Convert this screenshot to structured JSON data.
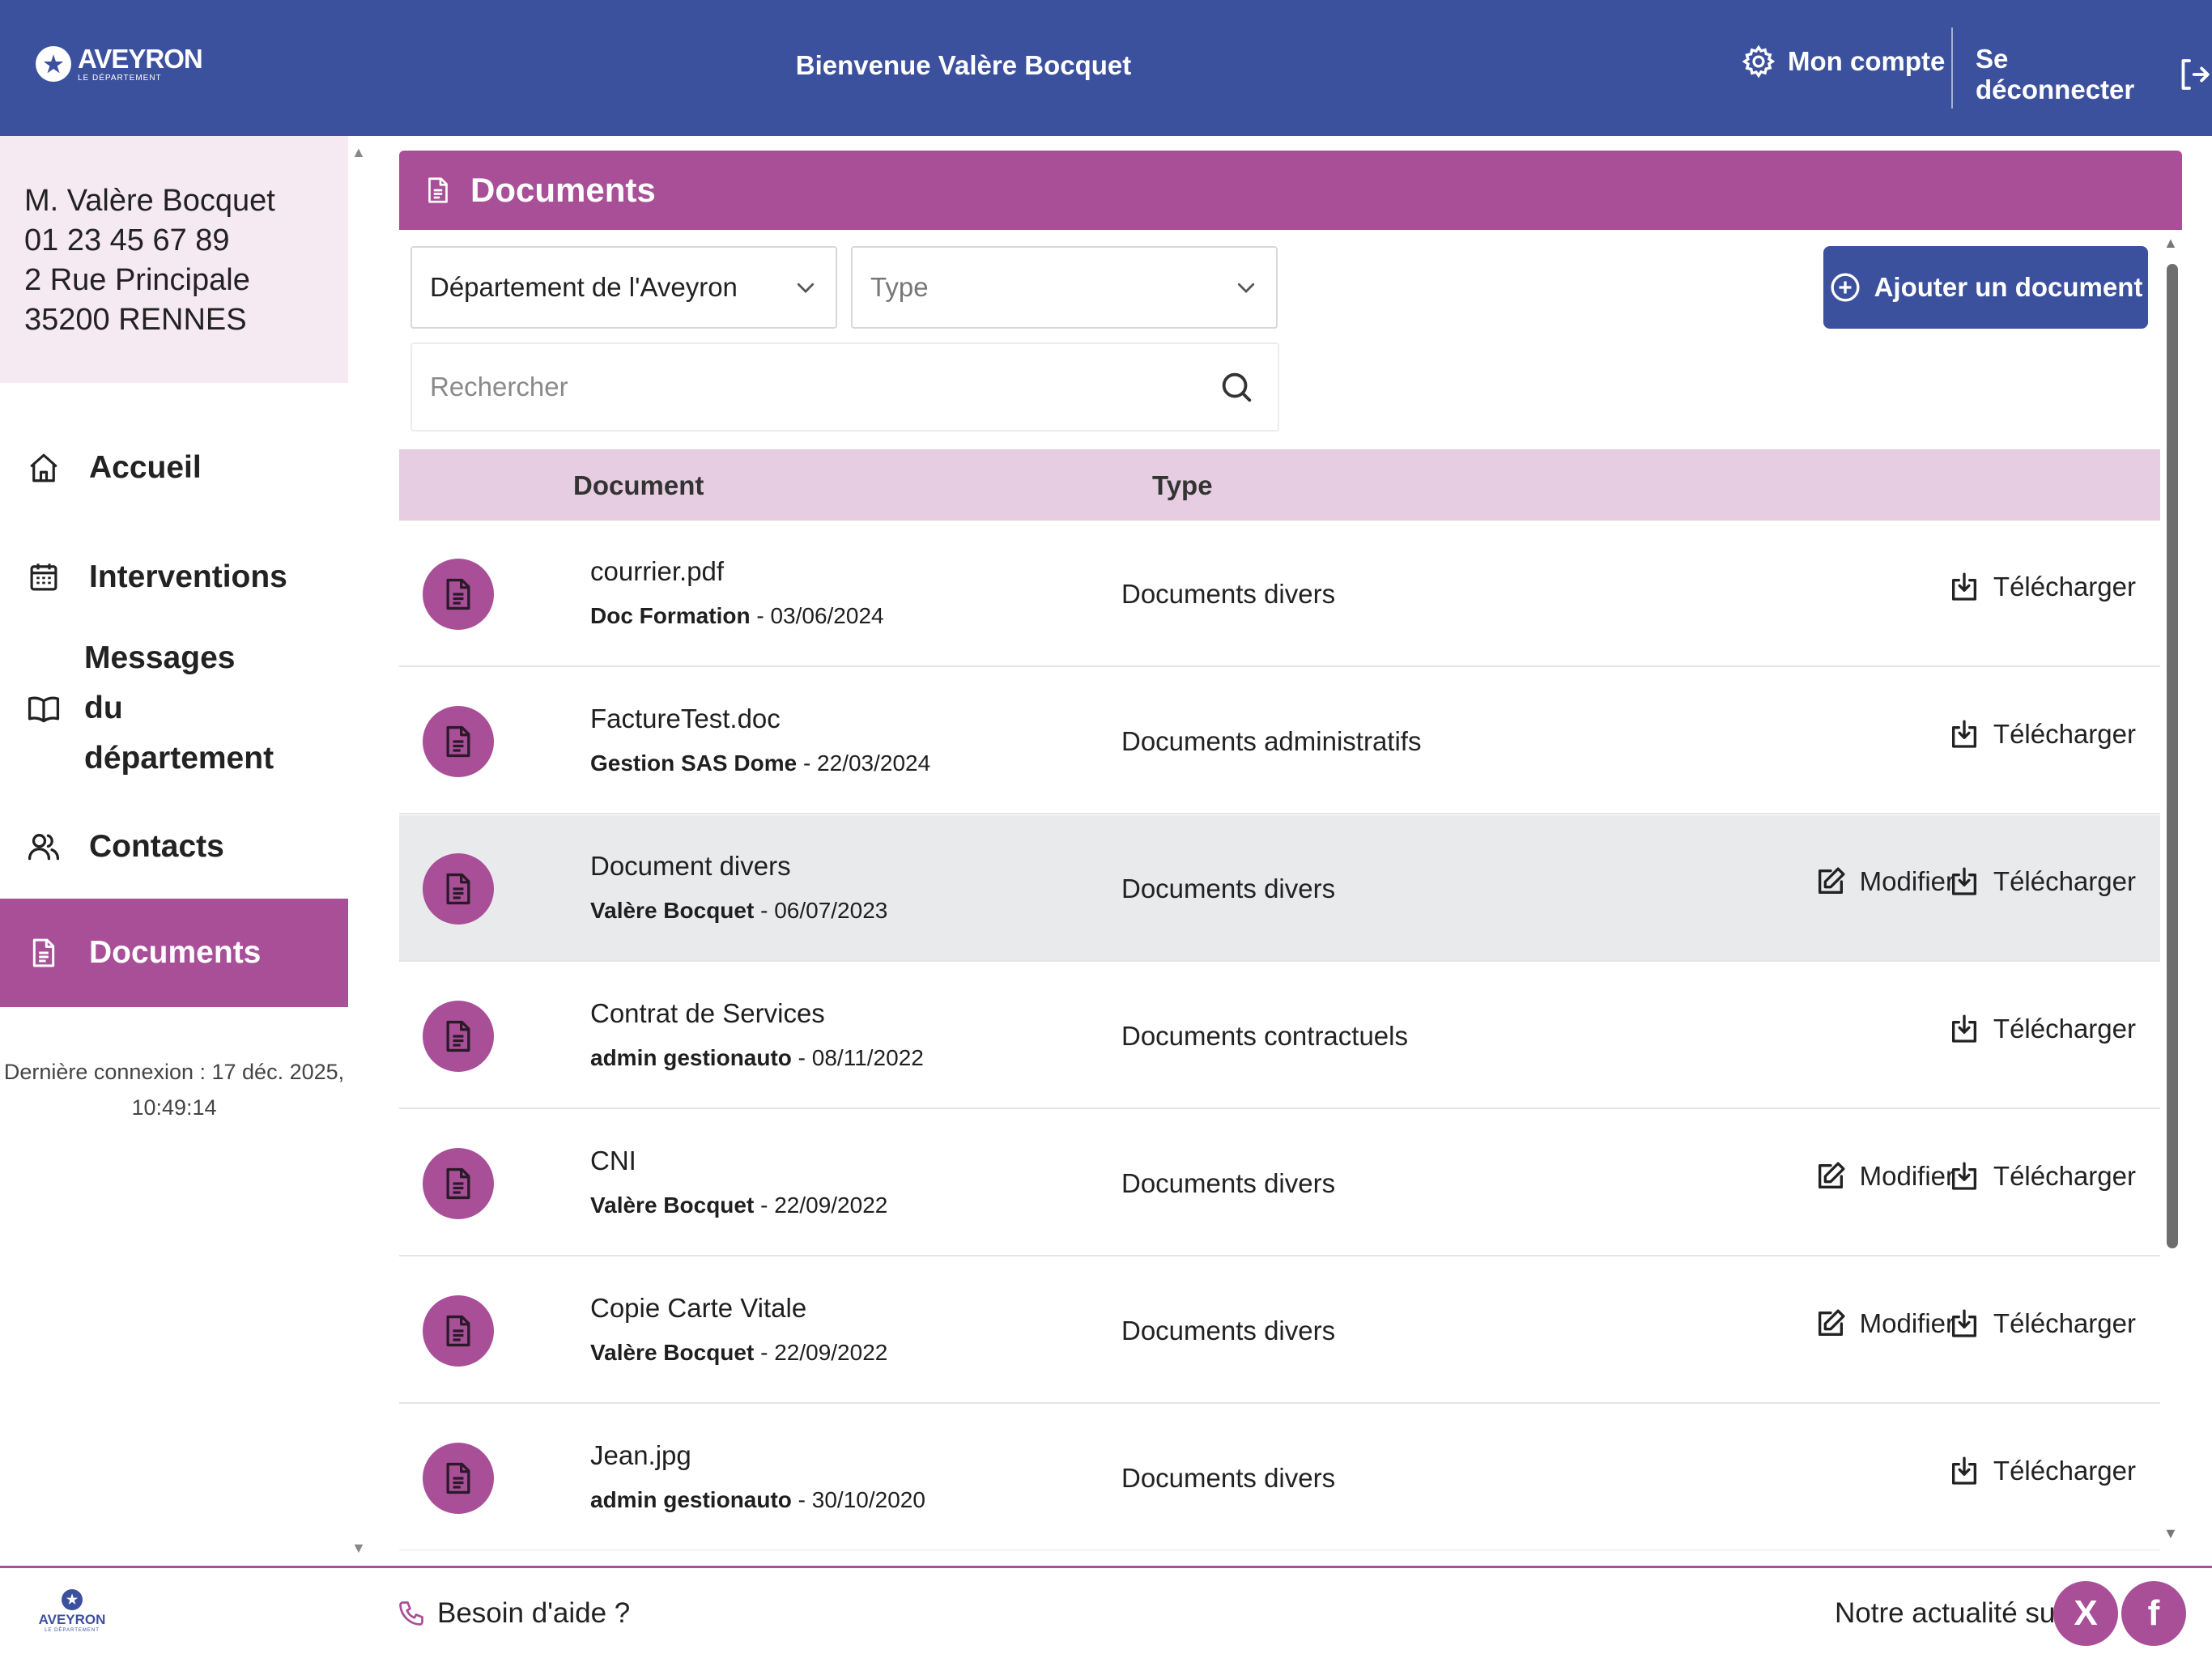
{
  "header": {
    "logo_name": "AVEYRON",
    "logo_sub": "LE DÉPARTEMENT",
    "welcome": "Bienvenue Valère Bocquet",
    "account_label": "Mon compte",
    "logout_label": "Se déconnecter"
  },
  "user": {
    "name": "M. Valère Bocquet",
    "phone": "01 23 45 67 89",
    "street": "2 Rue Principale",
    "city": "35200 RENNES"
  },
  "nav": [
    {
      "label": "Accueil",
      "icon": "home-icon"
    },
    {
      "label": "Interventions",
      "icon": "calendar-icon"
    },
    {
      "label": "Messages du département",
      "icon": "book-icon"
    },
    {
      "label": "Contacts",
      "icon": "users-icon"
    },
    {
      "label": "Documents",
      "icon": "document-icon",
      "active": true
    }
  ],
  "last_login": {
    "line1": "Dernière connexion : 17 déc. 2025,",
    "line2": "10:49:14"
  },
  "documents": {
    "title": "Documents",
    "filter_department": "Département de l'Aveyron",
    "filter_type_placeholder": "Type",
    "search_placeholder": "Rechercher",
    "add_button": "Ajouter un document",
    "col_document": "Document",
    "col_type": "Type",
    "rows": [
      {
        "name": "courrier.pdf",
        "author": "Doc Formation",
        "date": " - 03/06/2024",
        "type": "Documents divers",
        "modify": "",
        "download": "Télécharger"
      },
      {
        "name": "FactureTest.doc",
        "author": "Gestion SAS Dome",
        "date": " - 22/03/2024",
        "type": "Documents administratifs",
        "modify": "",
        "download": "Télécharger"
      },
      {
        "name": "Document divers",
        "author": "Valère Bocquet",
        "date": " - 06/07/2023",
        "type": "Documents divers",
        "modify": "Modifier",
        "download": "Télécharger"
      },
      {
        "name": "Contrat de Services",
        "author": "admin gestionauto",
        "date": " - 08/11/2022",
        "type": "Documents contractuels",
        "modify": "",
        "download": "Télécharger"
      },
      {
        "name": "CNI",
        "author": "Valère Bocquet",
        "date": " - 22/09/2022",
        "type": "Documents divers",
        "modify": "Modifier",
        "download": "Télécharger"
      },
      {
        "name": "Copie Carte Vitale",
        "author": "Valère Bocquet",
        "date": " - 22/09/2022",
        "type": "Documents divers",
        "modify": "Modifier",
        "download": "Télécharger"
      },
      {
        "name": "Jean.jpg",
        "author": "admin gestionauto",
        "date": " - 30/10/2020",
        "type": "Documents divers",
        "modify": "",
        "download": "Télécharger"
      }
    ]
  },
  "footer": {
    "logo_name": "AVEYRON",
    "logo_sub": "LE DÉPARTEMENT",
    "help": "Besoin d'aide ?",
    "news": "Notre actualité sur",
    "x_label": "X",
    "facebook_label": "f"
  },
  "colors": {
    "brand_blue": "#3c519e",
    "brand_purple": "#a84f98",
    "header_row": "#e6cde1",
    "card_bg": "#f5e9f2"
  }
}
